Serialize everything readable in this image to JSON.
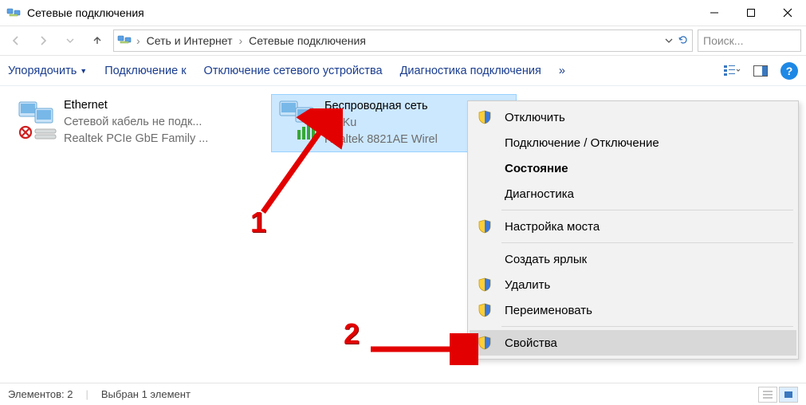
{
  "window": {
    "title": "Сетевые подключения"
  },
  "breadcrumb": {
    "parent": "Сеть и Интернет",
    "current": "Сетевые подключения"
  },
  "search": {
    "placeholder": "Поиск..."
  },
  "toolbar": {
    "organize": "Упорядочить",
    "connect_to": "Подключение к",
    "disable_device": "Отключение сетевого устройства",
    "diagnose": "Диагностика подключения",
    "more": "»"
  },
  "connections": [
    {
      "name": "Ethernet",
      "status": "Сетевой кабель не подк...",
      "device": "Realtek PCIe GbE Family ..."
    },
    {
      "name": "Беспроводная сеть",
      "status": "Ku-Ku",
      "device": "Realtek 8821AE Wirel"
    }
  ],
  "context_menu": {
    "items": [
      {
        "label": "Отключить",
        "shield": true
      },
      {
        "label": "Подключение / Отключение",
        "shield": false
      },
      {
        "label": "Состояние",
        "shield": false,
        "bold": true
      },
      {
        "label": "Диагностика",
        "shield": false
      },
      {
        "sep": true
      },
      {
        "label": "Настройка моста",
        "shield": true
      },
      {
        "sep": true
      },
      {
        "label": "Создать ярлык",
        "shield": false
      },
      {
        "label": "Удалить",
        "shield": true
      },
      {
        "label": "Переименовать",
        "shield": true
      },
      {
        "sep": true
      },
      {
        "label": "Свойства",
        "shield": true,
        "hover": true
      }
    ]
  },
  "annotations": {
    "a1": "1",
    "a2": "2"
  },
  "status": {
    "count": "Элементов: 2",
    "selected": "Выбран 1 элемент"
  }
}
